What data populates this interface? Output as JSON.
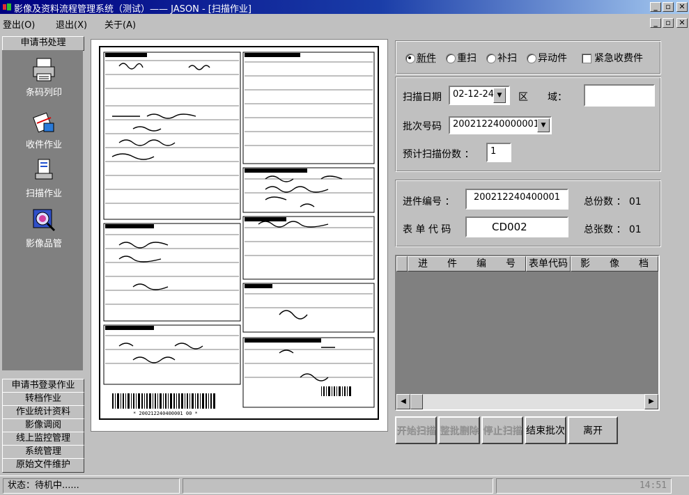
{
  "window": {
    "title": "影像及资料流程管理系统（测试）—— JASON - [扫描作业]"
  },
  "menu": {
    "items": [
      "登出(O)",
      "退出(X)",
      "关于(A)"
    ]
  },
  "sidebar": {
    "header": "申请书处理",
    "icons": [
      {
        "label": "条码列印",
        "icon": "printer-icon"
      },
      {
        "label": "收件作业",
        "icon": "receive-icon"
      },
      {
        "label": "扫描作业",
        "icon": "scanner-icon"
      },
      {
        "label": "影像品管",
        "icon": "image-qc-icon"
      }
    ],
    "bottom_buttons": [
      "申请书登录作业",
      "转档作业",
      "作业统计资料",
      "影像调阅",
      "线上监控管理",
      "系统管理",
      "原始文件维护"
    ]
  },
  "options": {
    "radios": [
      {
        "label": "新件",
        "checked": true
      },
      {
        "label": "重扫",
        "checked": false
      },
      {
        "label": "补扫",
        "checked": false
      },
      {
        "label": "异动件",
        "checked": false
      }
    ],
    "checkbox": {
      "label": "紧急收费件",
      "checked": false
    }
  },
  "scan_info": {
    "date_label": "扫描日期",
    "date_value": "02-12-24",
    "region_label": "区　　域：",
    "region_value": "",
    "batch_label": "批次号码",
    "batch_value": "200212240000001",
    "copies_label": "预计扫描份数 ：",
    "copies_value": "1"
  },
  "doc_info": {
    "intake_label": "进件编号 ：",
    "intake_value": "200212240400001",
    "total_copies_label": "总份数 ： 01",
    "form_code_label": "表 单 代 码",
    "form_code_value": "CD002",
    "total_sheets_label": "总张数 ： 01"
  },
  "grid": {
    "columns": [
      "进　　件　　编　　号",
      "表单代码",
      "影　　像　　档"
    ]
  },
  "actions": {
    "start_scan": "开始扫描",
    "delete_batch": "整批删除",
    "stop_scan": "停止扫描",
    "end_batch": "结束批次",
    "leave": "离开"
  },
  "status": {
    "text": "状态：待机中......",
    "time": "14:51"
  },
  "preview": {
    "barcode_text": "* 200212240400001 00 *"
  }
}
